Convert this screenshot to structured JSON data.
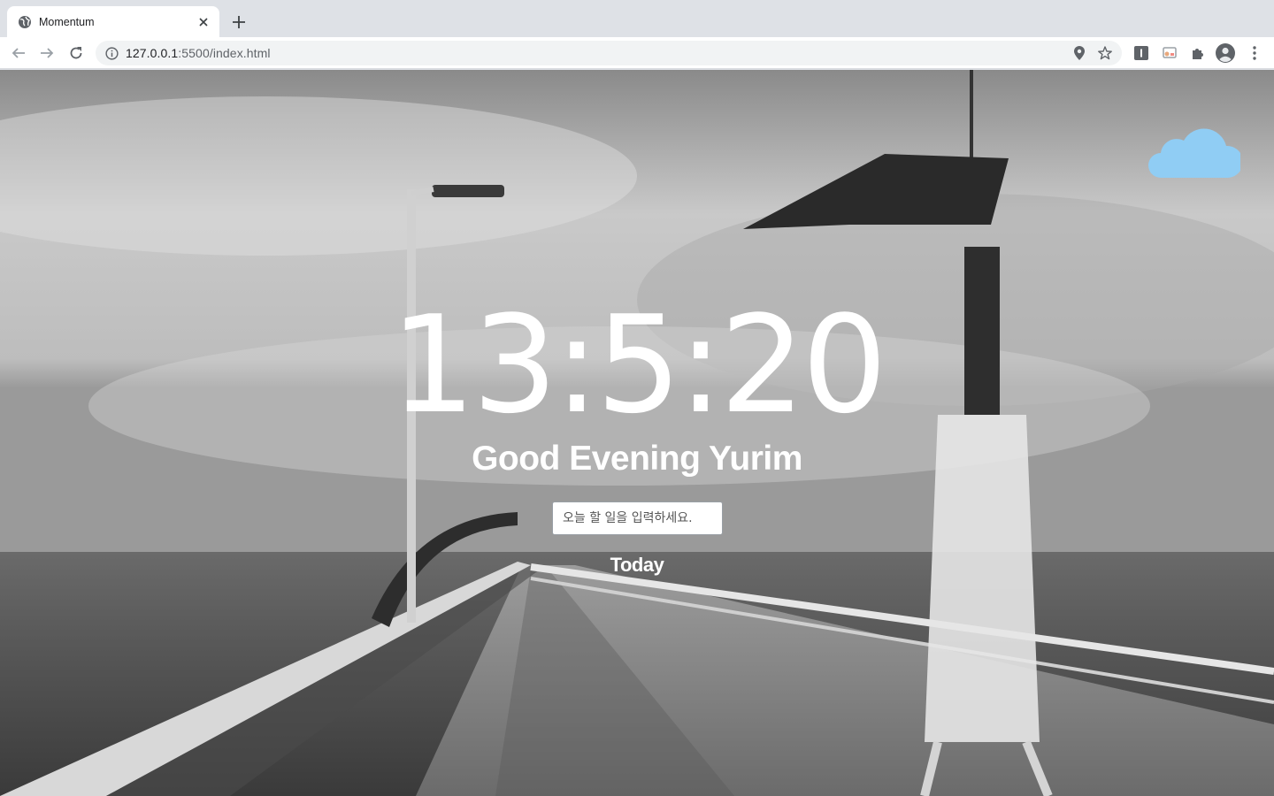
{
  "browser": {
    "tab_title": "Momentum",
    "url_host": "127.0.0.1",
    "url_path": ":5500/index.html"
  },
  "page": {
    "clock": "13:5:20",
    "greeting": "Good Evening Yurim",
    "todo_placeholder": "오늘 할 일을 입력하세요.",
    "today_heading": "Today",
    "weather_icon": "cloud-icon",
    "weather_color": "#90cdf4"
  }
}
